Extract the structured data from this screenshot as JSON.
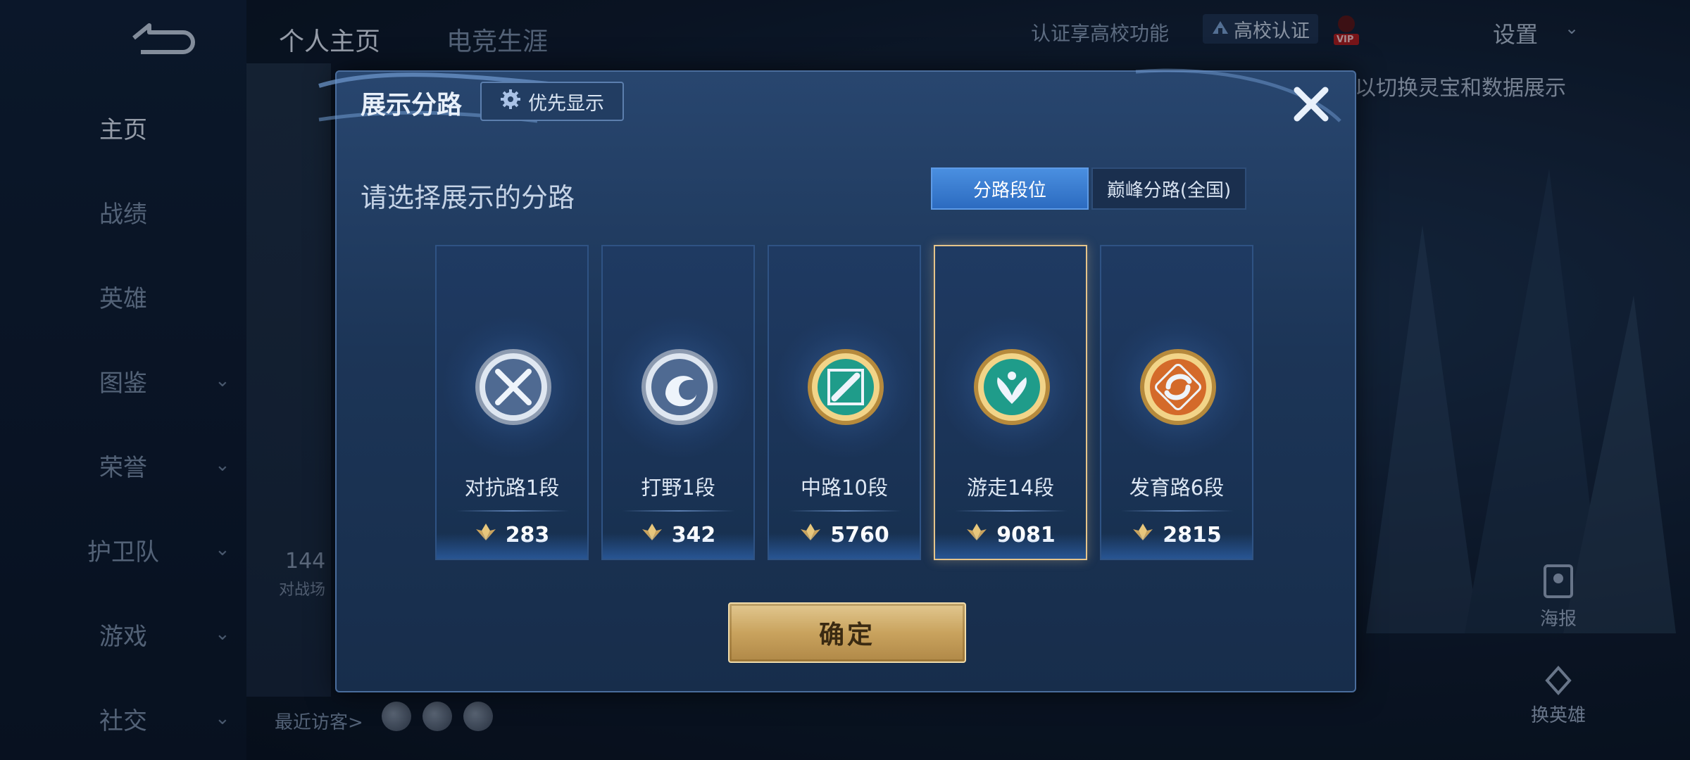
{
  "sidebar": {
    "items": [
      {
        "label": "主页",
        "active": true,
        "chevron": false
      },
      {
        "label": "战绩",
        "active": false,
        "chevron": false
      },
      {
        "label": "英雄",
        "active": false,
        "chevron": false
      },
      {
        "label": "图鉴",
        "active": false,
        "chevron": true
      },
      {
        "label": "荣誉",
        "active": false,
        "chevron": true
      },
      {
        "label": "护卫队",
        "active": false,
        "chevron": true
      },
      {
        "label": "游戏",
        "active": false,
        "chevron": true
      },
      {
        "label": "社交",
        "active": false,
        "chevron": true
      }
    ],
    "chevron_glyph": "⌄"
  },
  "header": {
    "tabs": [
      "个人主页",
      "电竞生涯"
    ],
    "campus_hint": "认证享高校功能",
    "campus_button": "高校认证",
    "vip_label": "VIP",
    "settings_label": "设置"
  },
  "background": {
    "hint_text": "以切换灵宝和数据展示",
    "stat_value": "144",
    "stat_caption": "对战场",
    "recent_visitors_label": "最近访客>",
    "poster_label": "海报",
    "switch_hero_label": "换英雄"
  },
  "modal": {
    "title": "展示分路",
    "priority_button": "优先显示",
    "subtitle": "请选择展示的分路",
    "segment_tabs": [
      {
        "label": "分路段位",
        "active": true
      },
      {
        "label": "巅峰分路(全国)",
        "active": false
      }
    ],
    "lanes": [
      {
        "label": "对抗路1段",
        "score": "283",
        "emblem": "clash-lane-icon",
        "tier": "silver",
        "selected": false
      },
      {
        "label": "打野1段",
        "score": "342",
        "emblem": "jungle-icon",
        "tier": "silver",
        "selected": false
      },
      {
        "label": "中路10段",
        "score": "5760",
        "emblem": "mid-lane-icon",
        "tier": "gold-teal",
        "selected": false
      },
      {
        "label": "游走14段",
        "score": "9081",
        "emblem": "roam-icon",
        "tier": "gold-teal",
        "selected": true
      },
      {
        "label": "发育路6段",
        "score": "2815",
        "emblem": "farm-lane-icon",
        "tier": "gold-orange",
        "selected": false
      }
    ],
    "confirm_label": "确定"
  },
  "colors": {
    "accent_blue": "#3d82d8",
    "selected_border": "#e5c48a",
    "gold_button": "#c9a35e"
  }
}
